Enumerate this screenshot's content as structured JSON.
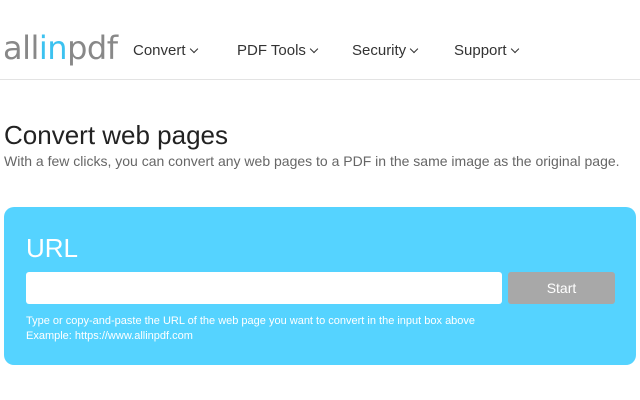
{
  "header": {
    "logo": {
      "part1": "all",
      "part2": "in",
      "part3": "pdf"
    },
    "nav": [
      {
        "label": "Convert"
      },
      {
        "label": "PDF Tools"
      },
      {
        "label": "Security"
      },
      {
        "label": "Support"
      }
    ]
  },
  "main": {
    "title": "Convert web pages",
    "subtitle": "With a few clicks, you can convert any web pages to a PDF in the same image as the original page."
  },
  "url_panel": {
    "label": "URL",
    "input_value": "",
    "start_label": "Start",
    "help_line1": "Type or copy-and-paste the URL of the web page you want to convert in the input box above",
    "help_line2": "Example: https://www.allinpdf.com"
  },
  "colors": {
    "panel_background": "#55d3ff",
    "logo_accent": "#3cc2f0",
    "logo_gray": "#888888",
    "start_button": "#a8a8a8"
  },
  "icons": {
    "nav_dropdown": "chevron-down-icon"
  }
}
